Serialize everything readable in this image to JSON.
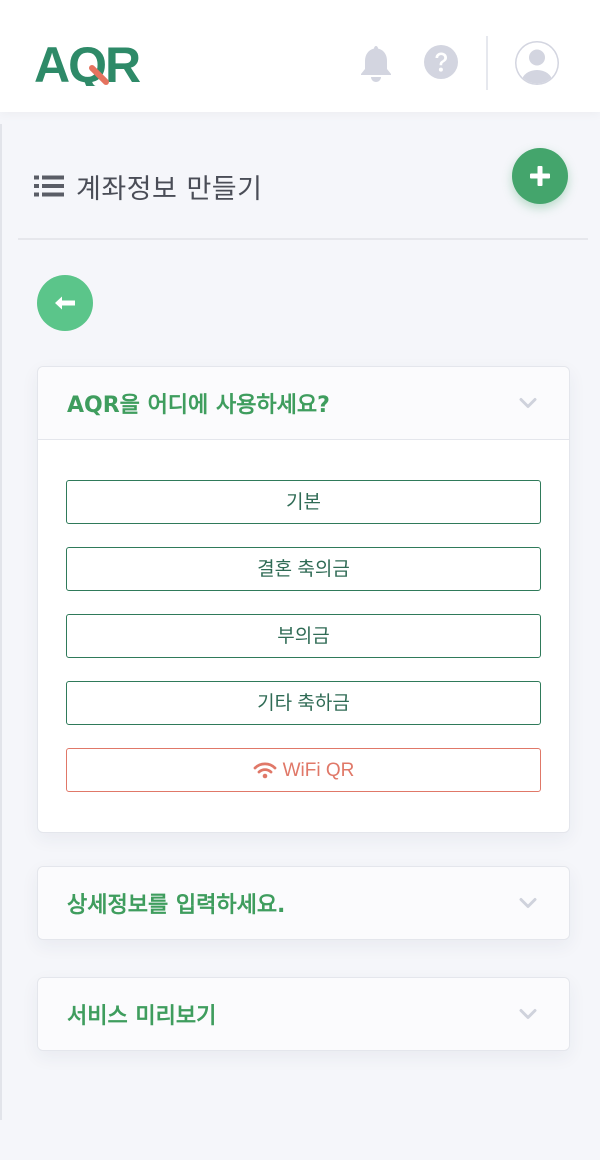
{
  "header": {
    "logo_text": "AQR",
    "icons": [
      "bell-icon",
      "question-circle-icon",
      "user-avatar-icon"
    ]
  },
  "page": {
    "title": "계좌정보 만들기",
    "title_icon": "list-icon",
    "add_icon": "plus-icon",
    "back_icon": "arrow-left-icon"
  },
  "sections": [
    {
      "title": "AQR을 어디에 사용하세요?",
      "options": [
        "기본",
        "결혼 축의금",
        "부의금",
        "기타 축하금"
      ],
      "wifi_label": "WiFi QR"
    },
    {
      "title": "상세정보를 입력하세요."
    },
    {
      "title": "서비스 미리보기"
    }
  ],
  "colors": {
    "brand_green": "#2e8a68",
    "accent_green": "#44a56c",
    "title_green": "#3f9d5e",
    "wifi_red": "#e07868",
    "icon_gray": "#d3d5e0"
  }
}
